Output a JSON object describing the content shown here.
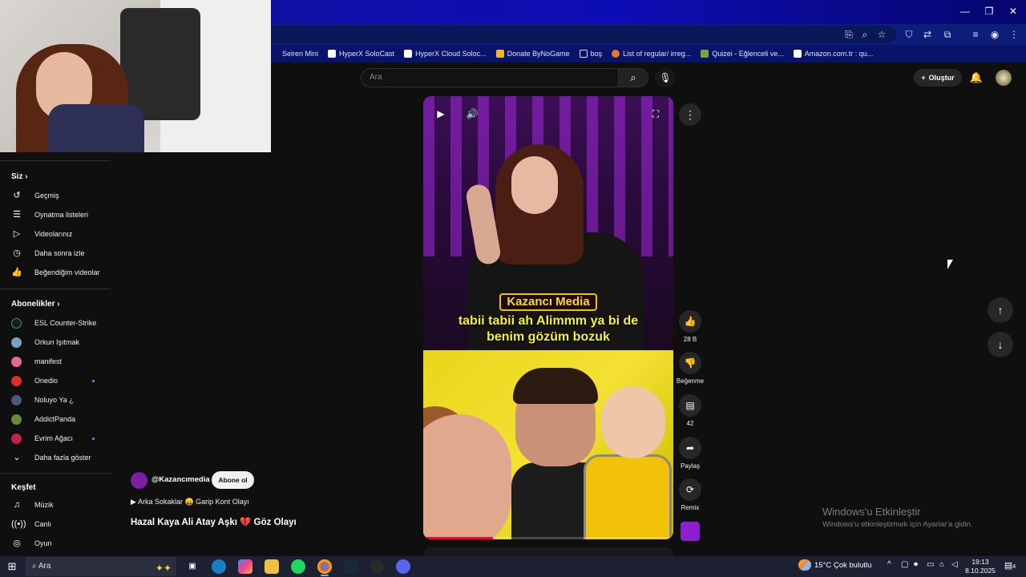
{
  "bookmarks": [
    {
      "label": "Seiren Mini",
      "color": "#08146a"
    },
    {
      "label": "HyperX SoloCast",
      "color": "#ffffff"
    },
    {
      "label": "HyperX Cloud Soloc...",
      "color": "#ffffff"
    },
    {
      "label": "Donate ByNoGame",
      "color": "#f0b429"
    },
    {
      "label": "boş",
      "color": "#08146a"
    },
    {
      "label": "List of regular/ irreg...",
      "color": "#e8732a"
    },
    {
      "label": "Quizei - Eğlenceli ve...",
      "color": "#7aa33a"
    },
    {
      "label": "Amazon.com.tr : qu...",
      "color": "#ffffff"
    }
  ],
  "search": {
    "placeholder": "Ara"
  },
  "header": {
    "create_label": "Oluştur"
  },
  "sidebar": {
    "you_heading": "Siz",
    "you_items": [
      {
        "label": "Geçmiş",
        "icon": "history-icon"
      },
      {
        "label": "Oynatma listeleri",
        "icon": "playlists-icon"
      },
      {
        "label": "Videolarınız",
        "icon": "your-videos-icon"
      },
      {
        "label": "Daha sonra izle",
        "icon": "watch-later-icon"
      },
      {
        "label": "Beğendiğim videolar",
        "icon": "liked-videos-icon"
      }
    ],
    "subs_heading": "Abonelikler",
    "subs": [
      {
        "label": "ESL Counter-Strike",
        "color": "#1b1b1b",
        "live": false
      },
      {
        "label": "Orkun Işıtmak",
        "color": "#7aa0c4",
        "live": false
      },
      {
        "label": "manifest",
        "color": "#e86a8a",
        "live": false
      },
      {
        "label": "Onedio",
        "color": "#e02b2b",
        "live": true
      },
      {
        "label": "Noluyo Ya ¿",
        "color": "#4a5a7a",
        "live": false
      },
      {
        "label": "AddictPanda",
        "color": "#6a8a3a",
        "live": false
      },
      {
        "label": "Evrim Ağacı",
        "color": "#c4204a",
        "live": true
      }
    ],
    "show_more": "Daha fazla göster",
    "explore_heading": "Keşfet",
    "explore": [
      {
        "label": "Müzik",
        "icon": "music-icon"
      },
      {
        "label": "Canlı",
        "icon": "live-icon"
      },
      {
        "label": "Oyun",
        "icon": "gaming-icon"
      }
    ]
  },
  "video": {
    "caption_brand": "Kazancı Media",
    "caption_line1": "tabii tabii ah Alimmm ya bi de",
    "caption_line2": "benim gözüm bozuk",
    "progress": 0.28
  },
  "actions": {
    "like_count": "28 B",
    "dislike_label": "Beğenme",
    "comment_count": "42",
    "share_label": "Paylaş",
    "remix_label": "Remix"
  },
  "info": {
    "channel": "@Kazancımedia",
    "subscribe": "Abone ol",
    "playlist": "Arka Sokaklar 😛 Garip Kont Olayı",
    "title": "Hazal Kaya Ali Atay Aşkı 💔 Göz Olayı"
  },
  "watermark": {
    "title": "Windows'u Etkinleştir",
    "subtitle": "Windows'u etkinleştirmek için Ayarlar'a gidin."
  },
  "taskbar": {
    "search_placeholder": "Ara",
    "weather": "15°C  Çok bulutlu",
    "time": "19:13",
    "date": "8.10.2025",
    "notif_count": "4"
  }
}
